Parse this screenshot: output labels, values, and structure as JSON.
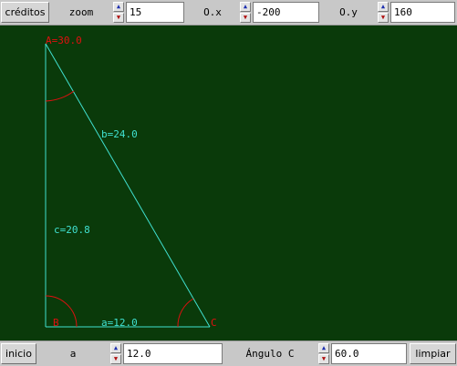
{
  "toolbar": {
    "credits_label": "créditos",
    "zoom_label": "zoom",
    "zoom_value": "15",
    "ox_label": "O.x",
    "ox_value": "-200",
    "oy_label": "O.y",
    "oy_value": "160"
  },
  "bottombar": {
    "start_label": "inicio",
    "side_a_label": "a",
    "side_a_value": "12.0",
    "angle_c_label": "Ángulo C",
    "angle_c_value": "60.0",
    "clear_label": "limpiar"
  },
  "spinner": {
    "up_glyph": "▲",
    "down_glyph": "▼"
  },
  "figure": {
    "vertex_a_label": "A=30.0",
    "vertex_b_label": "B",
    "vertex_c_label": "C",
    "side_b_label": "b=24.0",
    "side_c_label": "c=20.8",
    "side_a_label": "a=12.0",
    "colors": {
      "background": "#0a3a0a",
      "triangle": "#40e0d0",
      "arcs": "#e01010",
      "vertex_labels": "#e01010",
      "side_labels": "#40e0d0"
    }
  }
}
